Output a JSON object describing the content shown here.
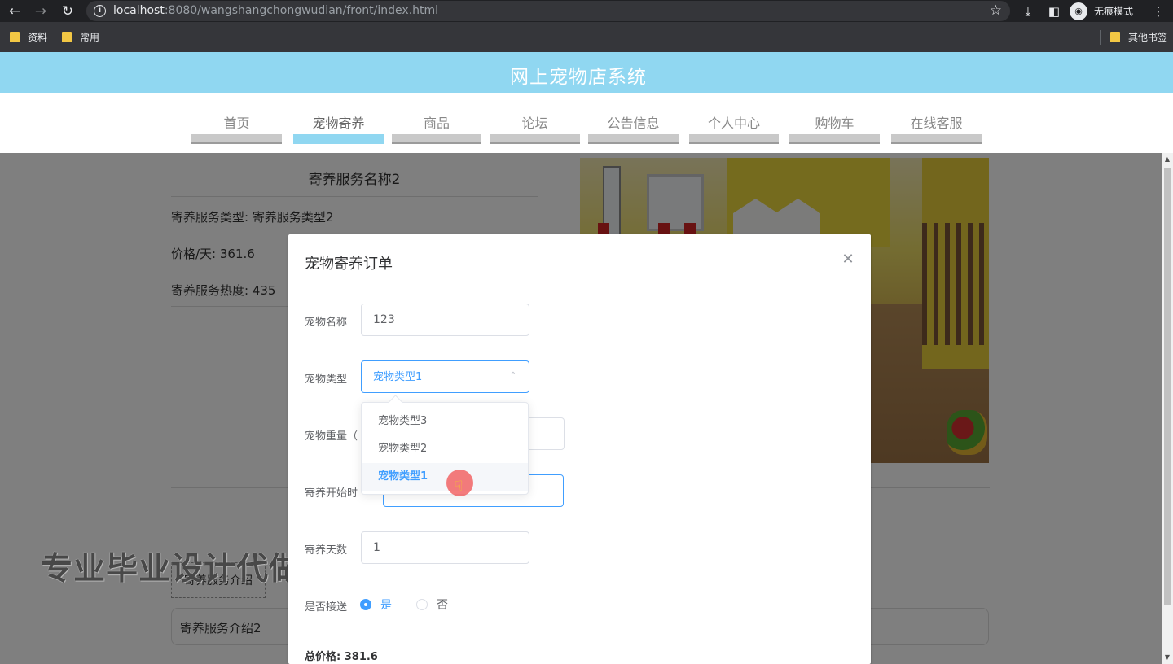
{
  "browser": {
    "url_host": "localhost",
    "url_path": ":8080/wangshangchongwudian/front/index.html",
    "incognito_label": "无痕模式",
    "bookmarks": [
      "资料",
      "常用"
    ],
    "other_bookmarks": "其他书签"
  },
  "site": {
    "title": "网上宠物店系统",
    "nav": [
      "首页",
      "宠物寄养",
      "商品",
      "论坛",
      "公告信息",
      "个人中心",
      "购物车",
      "在线客服"
    ],
    "active_nav": "宠物寄养"
  },
  "detail": {
    "name": "寄养服务名称2",
    "type_line": "寄养服务类型: 寄养服务类型2",
    "price_line": "价格/天: 361.6",
    "hot_line": "寄养服务热度: 435",
    "intro_tab": "寄养服务介绍",
    "intro_text": "寄养服务介绍2"
  },
  "watermark": "专业毕业设计代做",
  "dialog": {
    "title": "宠物寄养订单",
    "fields": {
      "pet_name_label": "宠物名称",
      "pet_name_value": "123",
      "pet_type_label": "宠物类型",
      "pet_type_placeholder": "宠物类型1",
      "pet_weight_label": "宠物重量（",
      "start_time_label": "寄养开始时",
      "days_label": "寄养天数",
      "days_value": "1",
      "pickup_label": "是否接送"
    },
    "pickup_options": [
      "是",
      "否"
    ],
    "pickup_selected": "是",
    "total": "总价格: 381.6",
    "dropdown_options": [
      "宠物类型3",
      "宠物类型2",
      "宠物类型1"
    ],
    "dropdown_selected": "宠物类型1"
  },
  "colors": {
    "header_bg": "#90d7f1",
    "primary": "#409eff"
  }
}
